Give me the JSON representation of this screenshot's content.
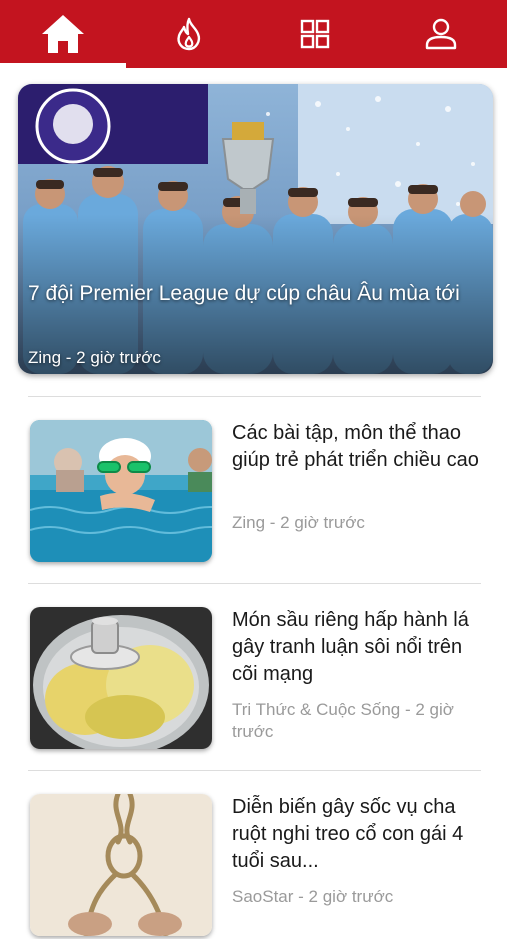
{
  "colors": {
    "brand": "#c3141f",
    "meta_text": "#9a9a9a",
    "title_text": "#1a1a1a"
  },
  "nav": {
    "items": [
      {
        "icon": "home-icon",
        "active": true
      },
      {
        "icon": "fire-icon",
        "active": false
      },
      {
        "icon": "grid-icon",
        "active": false
      },
      {
        "icon": "user-icon",
        "active": false
      }
    ]
  },
  "hero": {
    "title": "7 đội Premier League dự cúp châu Âu mùa tới",
    "meta": "Zing - 2 giờ trước"
  },
  "articles": [
    {
      "title": "Các bài tập, môn thể thao giúp trẻ phát triển chiều cao",
      "meta": "Zing - 2 giờ trước"
    },
    {
      "title": "Món sầu riêng hấp hành lá gây tranh luận sôi nổi trên cõi mạng",
      "meta": "Tri Thức & Cuộc Sống - 2 giờ trước"
    },
    {
      "title": "Diễn biến gây sốc vụ cha ruột nghi treo cổ con gái 4 tuổi sau...",
      "meta": "SaoStar - 2 giờ trước"
    }
  ]
}
